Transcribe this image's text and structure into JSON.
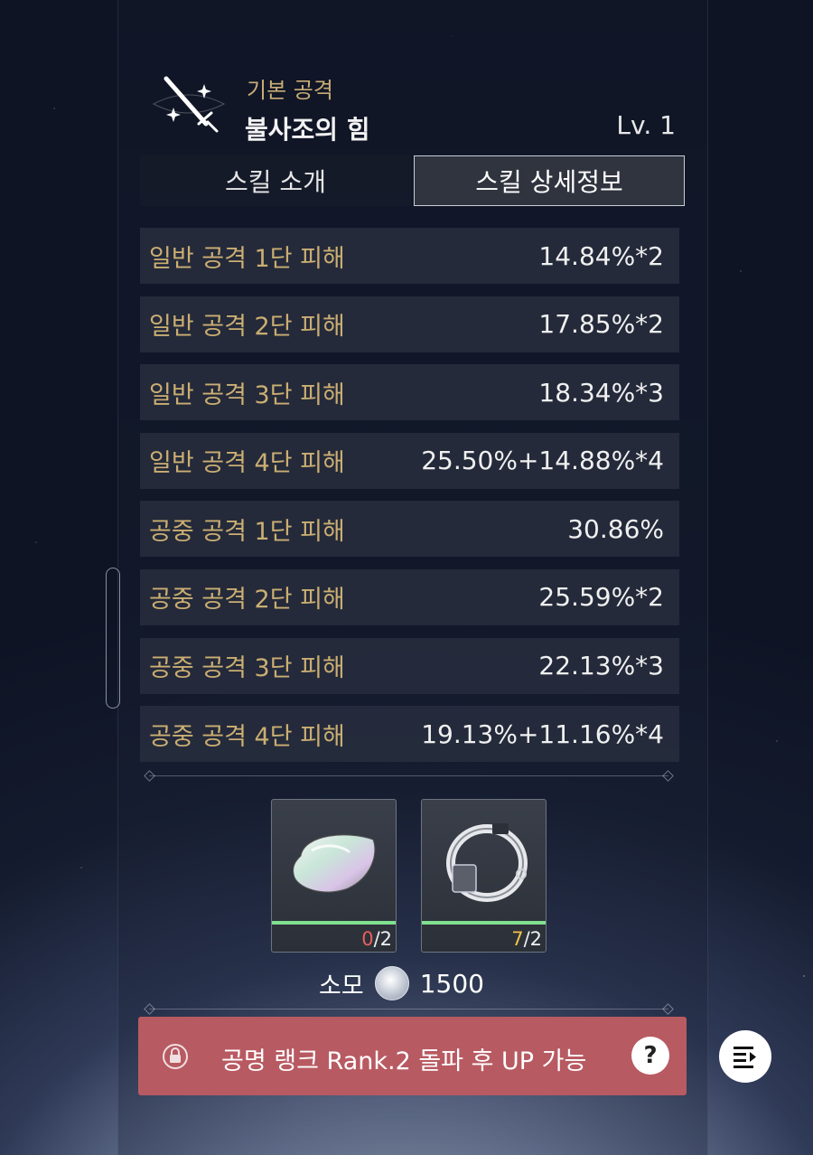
{
  "skill": {
    "category": "기본 공격",
    "name": "불사조의 힘",
    "level": "Lv. 1",
    "icon": "sword-icon"
  },
  "tabs": [
    {
      "label": "스킬 소개",
      "selected": false
    },
    {
      "label": "스킬 상세정보",
      "selected": true
    }
  ],
  "stats": [
    {
      "label": "일반 공격 1단 피해",
      "value": "14.84%*2"
    },
    {
      "label": "일반 공격 2단 피해",
      "value": "17.85%*2"
    },
    {
      "label": "일반 공격 3단 피해",
      "value": "18.34%*3"
    },
    {
      "label": "일반 공격 4단 피해",
      "value": "25.50%+14.88%*4"
    },
    {
      "label": "공중 공격 1단 피해",
      "value": "30.86%"
    },
    {
      "label": "공중 공격 2단 피해",
      "value": "25.59%*2"
    },
    {
      "label": "공중 공격 3단 피해",
      "value": "22.13%*3"
    },
    {
      "label": "공중 공격 4단 피해",
      "value": "19.13%+11.16%*4"
    }
  ],
  "materials": [
    {
      "icon": "iridescent-shell-icon",
      "have": "0",
      "need": "/2"
    },
    {
      "icon": "metal-ring-icon",
      "have": "7",
      "need": "/2"
    }
  ],
  "cost": {
    "label": "소모",
    "icon": "coin-icon",
    "value": "1500"
  },
  "upgrade": {
    "text": "공명 랭크 Rank.2 돌파 후 UP 가능",
    "locked": true
  },
  "colors": {
    "gold_label": "#cbae72",
    "locked_bar": "#b85a62",
    "progress": "#7fe08f"
  }
}
